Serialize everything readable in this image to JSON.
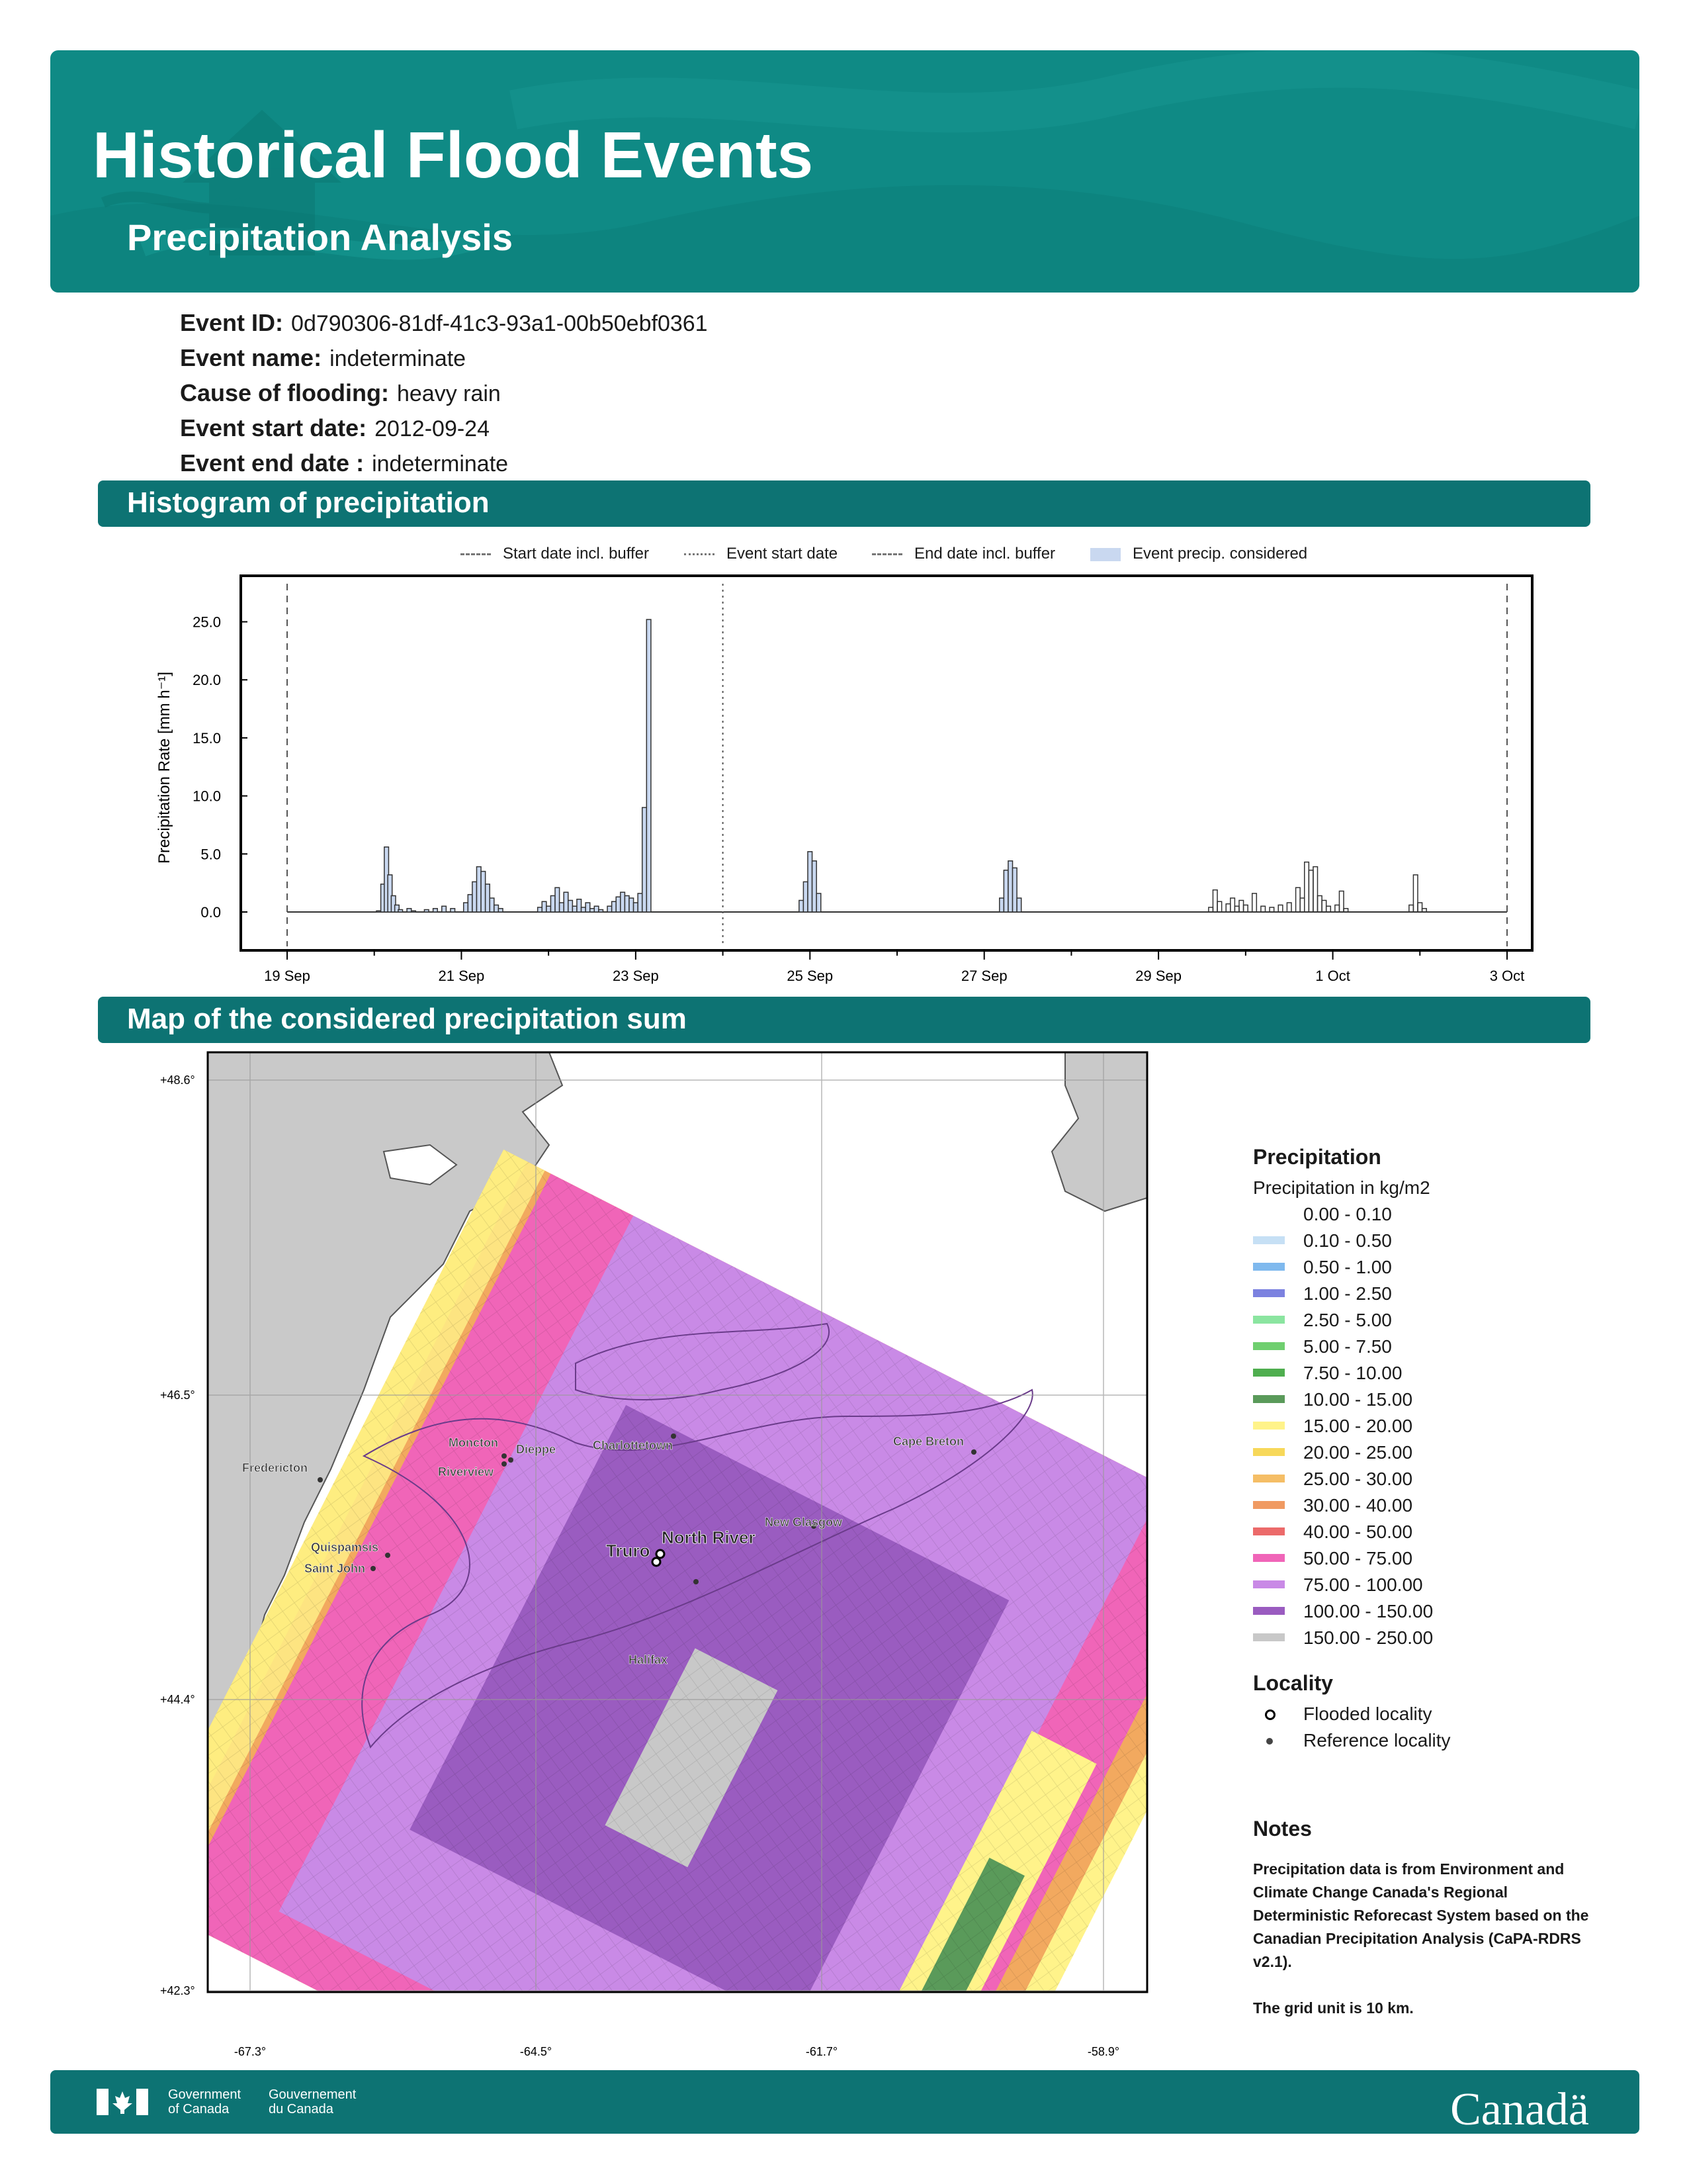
{
  "header": {
    "title": "Historical Flood Events",
    "subtitle": "Precipitation Analysis"
  },
  "event": {
    "id_label": "Event ID:",
    "id_value": "0d790306-81df-41c3-93a1-00b50ebf0361",
    "name_label": "Event name:",
    "name_value": "indeterminate",
    "cause_label": "Cause of flooding:",
    "cause_value": "heavy rain",
    "start_label": "Event start date:",
    "start_value": "2012-09-24",
    "end_label": "Event end date :",
    "end_value": "indeterminate"
  },
  "sections": {
    "histogram": "Histogram of precipitation",
    "map": "Map of the considered precipitation sum"
  },
  "chart_data": {
    "type": "bar",
    "ylabel": "Precipitation Rate [mm h⁻¹]",
    "xlabel": "",
    "ylim": [
      0,
      26
    ],
    "yticks": [
      "0.0",
      "5.0",
      "10.0",
      "15.0",
      "20.0",
      "25.0"
    ],
    "xtick_labels": [
      "19 Sep",
      "21 Sep",
      "23 Sep",
      "25 Sep",
      "27 Sep",
      "29 Sep",
      "1 Oct",
      "3 Oct"
    ],
    "x_range_days": [
      0,
      14
    ],
    "legend": {
      "start_buffer": "Start date incl. buffer",
      "event_start": "Event start date",
      "end_buffer": "End date incl. buffer",
      "considered": "Event precip. considered"
    },
    "start_buffer_day": 0,
    "event_start_day": 5,
    "end_buffer_day": 14,
    "series": [
      {
        "values": [
          [
            1.05,
            0.1
          ],
          [
            1.1,
            2.4
          ],
          [
            1.14,
            5.6
          ],
          [
            1.18,
            3.2
          ],
          [
            1.22,
            1.4
          ],
          [
            1.26,
            0.6
          ],
          [
            1.3,
            0.2
          ],
          [
            1.4,
            0.3
          ],
          [
            1.45,
            0.1
          ],
          [
            1.6,
            0.2
          ],
          [
            1.7,
            0.3
          ],
          [
            1.8,
            0.5
          ],
          [
            1.9,
            0.3
          ],
          [
            2.05,
            0.8
          ],
          [
            2.1,
            1.5
          ],
          [
            2.15,
            2.6
          ],
          [
            2.2,
            3.9
          ],
          [
            2.25,
            3.5
          ],
          [
            2.3,
            2.4
          ],
          [
            2.35,
            1.2
          ],
          [
            2.4,
            0.6
          ],
          [
            2.45,
            0.3
          ],
          [
            2.9,
            0.4
          ],
          [
            2.95,
            0.9
          ],
          [
            3.0,
            0.5
          ],
          [
            3.05,
            1.4
          ],
          [
            3.1,
            2.1
          ],
          [
            3.15,
            0.8
          ],
          [
            3.2,
            1.7
          ],
          [
            3.25,
            1.0
          ],
          [
            3.3,
            0.5
          ],
          [
            3.35,
            1.1
          ],
          [
            3.4,
            0.4
          ],
          [
            3.45,
            0.8
          ],
          [
            3.5,
            0.3
          ],
          [
            3.55,
            0.5
          ],
          [
            3.6,
            0.2
          ],
          [
            3.7,
            0.5
          ],
          [
            3.75,
            0.9
          ],
          [
            3.8,
            1.3
          ],
          [
            3.85,
            1.7
          ],
          [
            3.9,
            1.4
          ],
          [
            3.95,
            1.2
          ],
          [
            4.0,
            0.8
          ],
          [
            4.05,
            1.6
          ],
          [
            4.1,
            9.0
          ],
          [
            4.15,
            25.2
          ],
          [
            5.9,
            1.0
          ],
          [
            5.95,
            2.6
          ],
          [
            6.0,
            5.2
          ],
          [
            6.05,
            4.4
          ],
          [
            6.1,
            1.6
          ],
          [
            8.2,
            1.2
          ],
          [
            8.25,
            3.6
          ],
          [
            8.3,
            4.4
          ],
          [
            8.35,
            3.8
          ],
          [
            8.4,
            1.2
          ]
        ]
      },
      {
        "values": [
          [
            10.6,
            0.4
          ],
          [
            10.65,
            1.9
          ],
          [
            10.7,
            0.9
          ],
          [
            10.8,
            0.7
          ],
          [
            10.85,
            1.2
          ],
          [
            10.9,
            0.5
          ],
          [
            10.95,
            1.0
          ],
          [
            11.0,
            0.6
          ],
          [
            11.1,
            1.6
          ],
          [
            11.2,
            0.5
          ],
          [
            11.3,
            0.4
          ],
          [
            11.4,
            0.6
          ],
          [
            11.5,
            0.8
          ],
          [
            11.6,
            2.1
          ],
          [
            11.65,
            1.2
          ],
          [
            11.7,
            4.3
          ],
          [
            11.75,
            3.6
          ],
          [
            11.8,
            3.9
          ],
          [
            11.85,
            1.4
          ],
          [
            11.9,
            1.0
          ],
          [
            11.95,
            0.5
          ],
          [
            12.05,
            0.6
          ],
          [
            12.1,
            1.8
          ],
          [
            12.15,
            0.3
          ],
          [
            12.9,
            0.6
          ],
          [
            12.95,
            3.2
          ],
          [
            13.0,
            0.8
          ],
          [
            13.05,
            0.3
          ]
        ]
      }
    ]
  },
  "map": {
    "lat_labels": [
      "+48.6°",
      "+46.5°",
      "+44.4°",
      "+42.3°"
    ],
    "lon_labels": [
      "-67.3°",
      "-64.5°",
      "-61.7°",
      "-58.9°"
    ],
    "localities": {
      "moncton": "Moncton",
      "dieppe": "Dieppe",
      "riverview": "Riverview",
      "charlottetown": "Charlottetown",
      "cape_breton": "Cape Breton",
      "fredericton": "Fredericton",
      "new_glasgow": "New Glasgow",
      "quispamsis": "Quispamsis",
      "saint_john": "Saint John",
      "truro": "Truro",
      "north_river": "North River",
      "halifax": "Halifax"
    }
  },
  "legend": {
    "precip_title": "Precipitation",
    "precip_units": "Precipitation in kg/m2",
    "classes": [
      {
        "label": "0.00 - 0.10",
        "color": "#ffffff"
      },
      {
        "label": "0.10 - 0.50",
        "color": "#c6e0f5"
      },
      {
        "label": "0.50 - 1.00",
        "color": "#7fb9ee"
      },
      {
        "label": "1.00 - 2.50",
        "color": "#7c82e0"
      },
      {
        "label": "2.50 - 5.00",
        "color": "#8be5a0"
      },
      {
        "label": "5.00 - 7.50",
        "color": "#6fcf6f"
      },
      {
        "label": "7.50 - 10.00",
        "color": "#4fae4f"
      },
      {
        "label": "10.00 - 15.00",
        "color": "#5a9a5a"
      },
      {
        "label": "15.00 - 20.00",
        "color": "#fff38a"
      },
      {
        "label": "20.00 - 25.00",
        "color": "#f7d85a"
      },
      {
        "label": "25.00 - 30.00",
        "color": "#f5be66"
      },
      {
        "label": "30.00 - 40.00",
        "color": "#f09a62"
      },
      {
        "label": "40.00 - 50.00",
        "color": "#ec6a6a"
      },
      {
        "label": "50.00 - 75.00",
        "color": "#f065b8"
      },
      {
        "label": "75.00 - 100.00",
        "color": "#c98ae6"
      },
      {
        "label": "100.00 - 150.00",
        "color": "#9a5cc0"
      },
      {
        "label": "150.00 - 250.00",
        "color": "#c8c8c8"
      }
    ],
    "locality_title": "Locality",
    "flooded": "Flooded locality",
    "reference": "Reference locality"
  },
  "notes": {
    "title": "Notes",
    "text1": "Precipitation data is from Environment and Climate Change Canada's Regional Deterministic Reforecast System based on the Canadian Precipitation Analysis (CaPA-RDRS v2.1).",
    "text2": "The grid unit is 10 km."
  },
  "footer": {
    "gov_en_1": "Government",
    "gov_en_2": "of Canada",
    "gov_fr_1": "Gouvernement",
    "gov_fr_2": "du Canada",
    "wordmark": "Canadä"
  }
}
